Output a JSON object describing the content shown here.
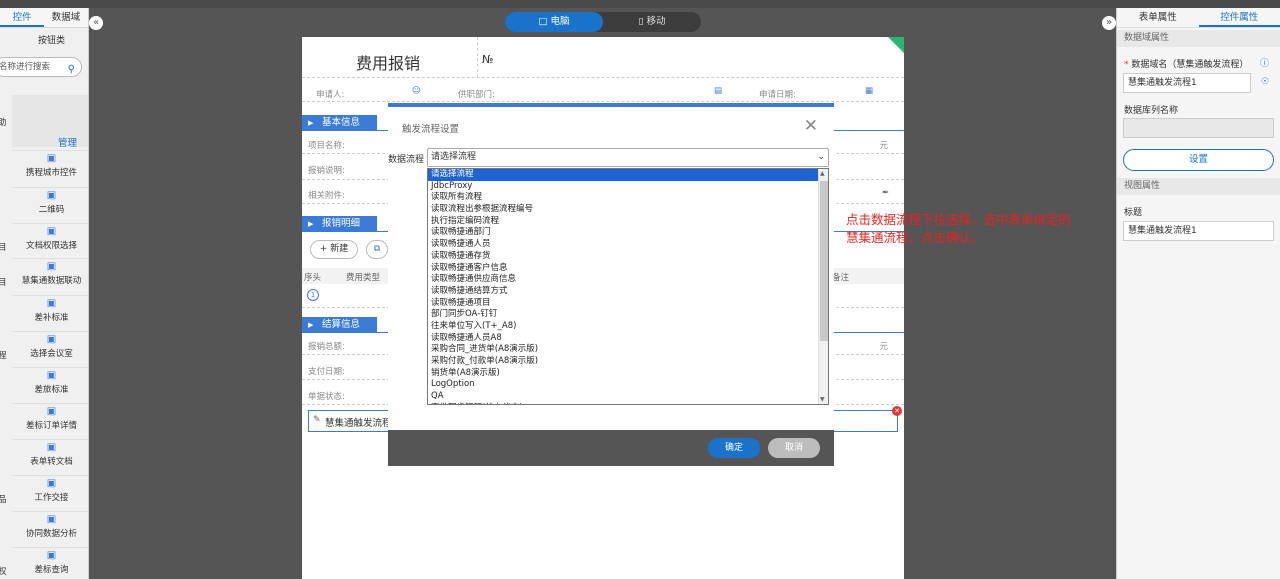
{
  "left_panel": {
    "tabs": [
      "控件",
      "数据域"
    ],
    "category": "按钮类",
    "search_placeholder": "名称进行搜索",
    "cut_text_1": "助",
    "manage_label": "管理",
    "items": [
      {
        "label": "携程城市控件",
        "cut": ""
      },
      {
        "label": "二维码",
        "cut": ""
      },
      {
        "label": "文档权限选择",
        "cut": "目"
      },
      {
        "label": "慧集通数据联动",
        "cut": "目"
      },
      {
        "label": "差补标准",
        "cut": ""
      },
      {
        "label": "选择会议室",
        "cut": "程"
      },
      {
        "label": "差旅标准",
        "cut": ""
      },
      {
        "label": "差标订单详情",
        "cut": ""
      },
      {
        "label": "表单转文档",
        "cut": ""
      },
      {
        "label": "工作交接",
        "cut": "品"
      },
      {
        "label": "协同数据分析",
        "cut": ""
      },
      {
        "label": "差标查询",
        "cut": "权"
      }
    ]
  },
  "device_toggle": {
    "desktop": "电脑",
    "mobile": "移动"
  },
  "right_panel": {
    "tabs": [
      "表单属性",
      "控件属性"
    ],
    "section_data": "数据域属性",
    "field_name_label": "数据域名（慧集通触发流程）",
    "field_name_value": "慧集通触发流程1",
    "column_label": "数据库列名称",
    "setup_button": "设置",
    "section_view": "视图属性",
    "title_label": "标题",
    "title_value": "慧集通触发流程1"
  },
  "form": {
    "title": "费用报销",
    "number_label": "№",
    "applicant": "申请人:",
    "department": "供职部门:",
    "apply_date": "申请日期:",
    "sec_basic": "基本信息",
    "project_name": "项目名称:",
    "desc": "报销说明:",
    "attachments": "相关附件:",
    "sec_detail": "报销明细",
    "new_button": "新建",
    "col_serial": "序头",
    "col_type": "费用类型",
    "col_remark": "备注",
    "row_num": "1",
    "sec_settle": "结算信息",
    "total": "报销总额:",
    "pay_date": "支付日期:",
    "bill_status": "单据状态:",
    "currency": "元",
    "flow_field": "慧集通触发流程1"
  },
  "modal": {
    "title": "触发流程设置",
    "field_label": "数据流程",
    "selected": "请选择流程",
    "options": [
      "请选择流程",
      "JdbcProxy",
      "读取所有流程",
      "读取流程出参根据流程编号",
      "执行指定编码流程",
      "读取畅捷通部门",
      "读取畅捷通人员",
      "读取畅捷通存货",
      "读取畅捷通客户信息",
      "读取畅捷通供应商信息",
      "读取畅捷通结算方式",
      "读取畅捷通项目",
      "部门同步OA-钉钉",
      "往来单位写入(T+_A8)",
      "读取畅捷通人员A8",
      "采购合同_进货单(A8演示版)",
      "采购付款_付款单(A8演示版)",
      "销货单(A8演示版)",
      "LogOption",
      "QA",
      "审批同步钉钉(待办状态)"
    ],
    "ok": "确定",
    "cancel": "取消"
  },
  "annotation": "点击数据流程下拉选择，选中表单绑定的慧集通流程，点击确认。",
  "colors": {
    "accent": "#1a73c8",
    "section": "#3a7bd5",
    "annotation": "#e8231f"
  }
}
